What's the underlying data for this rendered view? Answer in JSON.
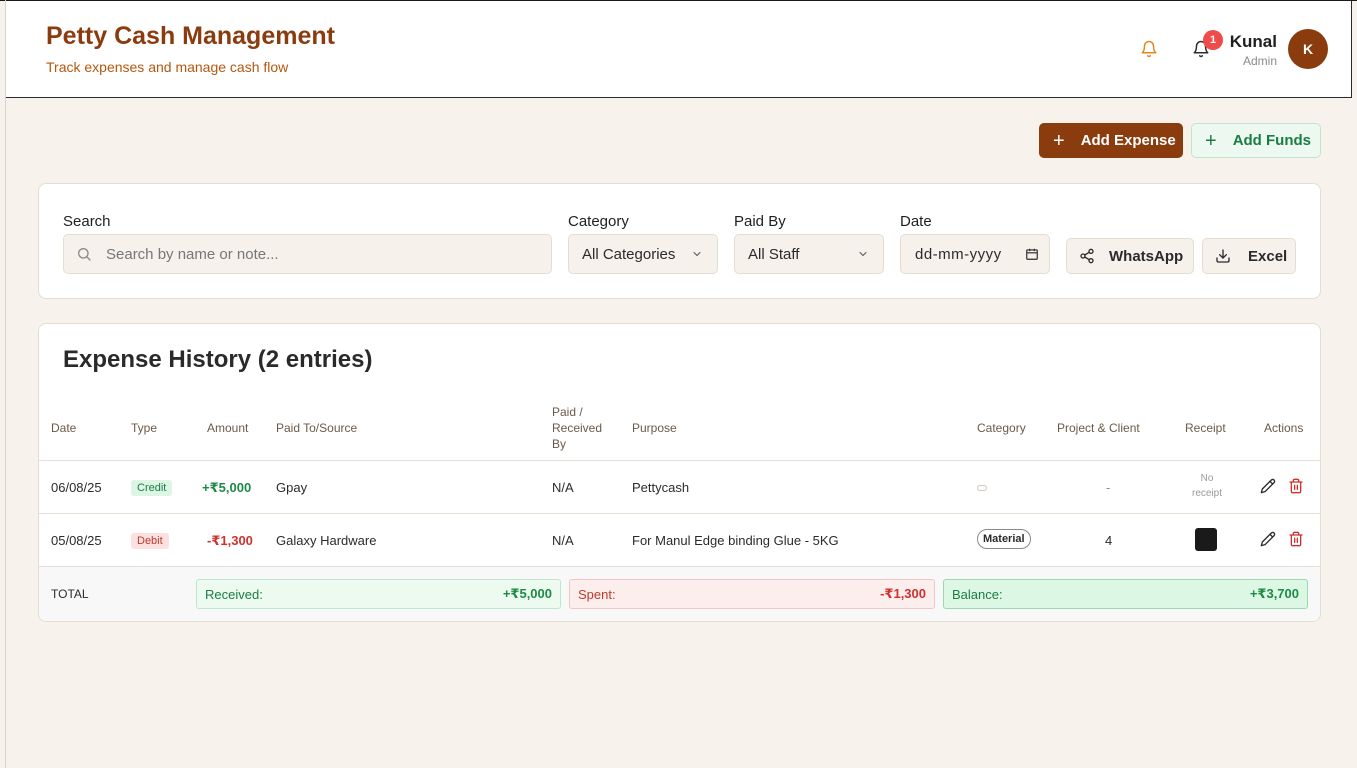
{
  "header": {
    "title": "Petty Cash Management",
    "subtitle": "Track expenses and manage cash flow",
    "notification_count": "1",
    "user_name": "Kunal",
    "user_role": "Admin",
    "avatar_initial": "K"
  },
  "actions": {
    "add_expense_label": "Add Expense",
    "add_funds_label": "Add Funds"
  },
  "filters": {
    "search_label": "Search",
    "search_placeholder": "Search by name or note...",
    "category_label": "Category",
    "category_value": "All Categories",
    "paid_by_label": "Paid By",
    "paid_by_value": "All Staff",
    "date_label": "Date",
    "date_placeholder": "dd-mm-yyyy",
    "whatsapp_label": "WhatsApp",
    "excel_label": "Excel"
  },
  "history": {
    "title": "Expense History (2 entries)",
    "columns": {
      "date": "Date",
      "type": "Type",
      "amount": "Amount",
      "paid_to": "Paid To/Source",
      "paid_by_1": "Paid /",
      "paid_by_2": "Received",
      "paid_by_3": "By",
      "purpose": "Purpose",
      "category": "Category",
      "project": "Project & Client",
      "receipt": "Receipt",
      "actions": "Actions"
    },
    "rows": [
      {
        "date": "06/08/25",
        "type": "Credit",
        "amount": "+₹5,000",
        "paid_to": "Gpay",
        "paid_by": "N/A",
        "purpose": "Pettycash",
        "category": "",
        "project": "-",
        "receipt_line1": "No",
        "receipt_line2": "receipt"
      },
      {
        "date": "05/08/25",
        "type": "Debit",
        "amount": "-₹1,300",
        "paid_to": "Galaxy Hardware",
        "paid_by": "N/A",
        "purpose": "For Manul Edge binding Glue - 5KG",
        "category": "Material",
        "project": "4",
        "receipt_line1": "",
        "receipt_line2": ""
      }
    ],
    "totals": {
      "label": "TOTAL",
      "received_label": "Received:",
      "received_value": "+₹5,000",
      "spent_label": "Spent:",
      "spent_value": "-₹1,300",
      "balance_label": "Balance:",
      "balance_value": "+₹3,700"
    }
  },
  "colors": {
    "brand": "#8a3c0e",
    "credit": "#1e8a47",
    "debit": "#d0312d",
    "background": "#f7f3ec"
  },
  "icons": [
    "bell-icon",
    "plus-icon",
    "search-icon",
    "chevron-down-icon",
    "calendar-icon",
    "share-icon",
    "download-icon",
    "pencil-icon",
    "trash-icon"
  ]
}
